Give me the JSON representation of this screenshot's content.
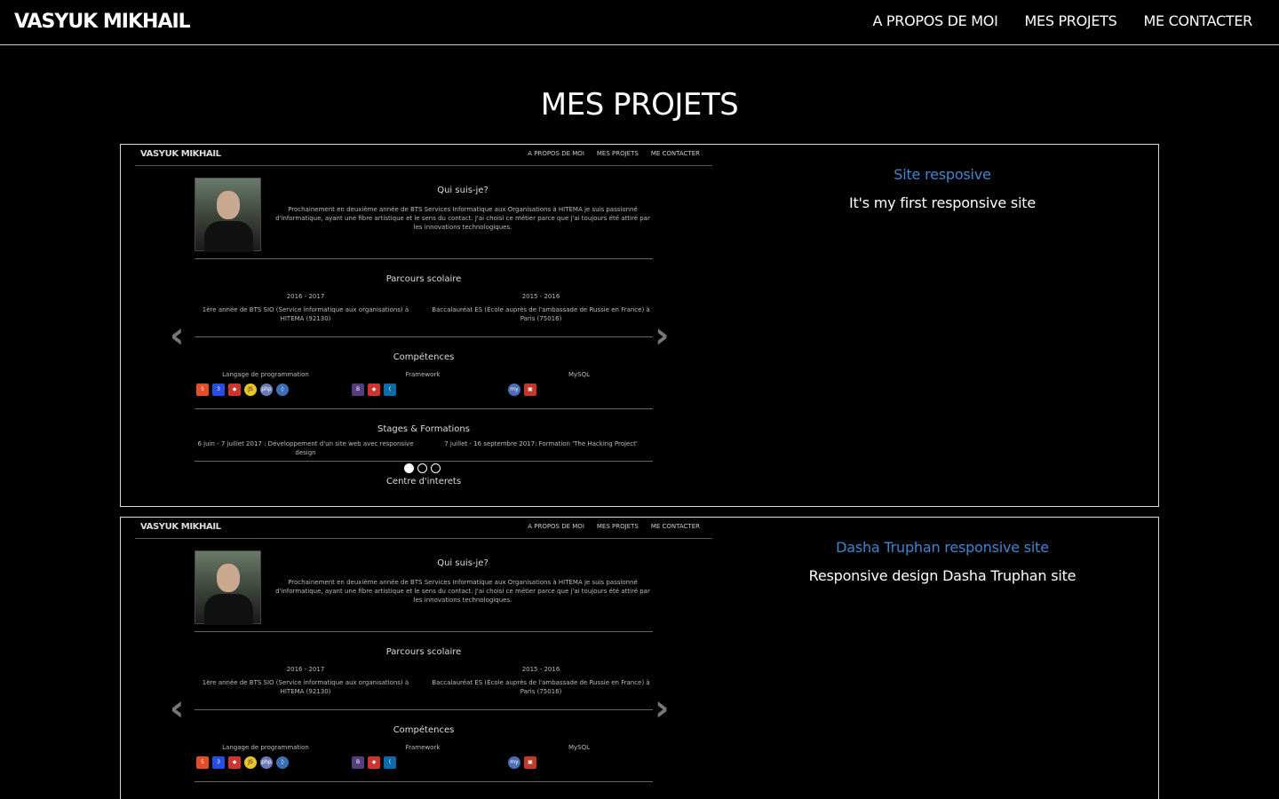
{
  "nav": {
    "brand": "VASYUK MIKHAIL",
    "links": [
      "A PROPOS DE MOI",
      "MES PROJETS",
      "ME CONTACTER"
    ]
  },
  "section_title": "MES PROJETS",
  "colors": {
    "background": "#000000",
    "link": "#3f86d1",
    "text": "#ffffff",
    "border": "#d9d9d9"
  },
  "preview": {
    "brand": "VASYUK MIKHAIL",
    "nav_links": [
      "A PROPOS DE MOI",
      "MES PROJETS",
      "ME CONTACTER"
    ],
    "about_title": "Qui suis-je?",
    "about_text": "Prochainement en deuxième année de BTS Services Informatique aux Organisations à HITEMA je suis passionné d'informatique, ayant une fibre artistique et le sens du contact. J'ai choisi ce métier parce que j'ai toujours été attiré par les innovations technologiques.",
    "school_title": "Parcours scolaire",
    "school": [
      {
        "years": "2016 - 2017",
        "text": "1ère année de BTS SIO (Service informatique aux organisations) à HITEMA (92130)"
      },
      {
        "years": "2015 - 2016",
        "text": "Baccalauréat ES (École auprès de l'ambassade de Russie en France) à Paris (75016)"
      }
    ],
    "skills_title": "Compétences",
    "skills": [
      "Langage de programmation",
      "Framework",
      "MySQL"
    ],
    "internships_title": "Stages & Formations",
    "internships": [
      "6 juin - 7 juillet 2017 : Développement d'un site web avec responsive design",
      "7 juillet - 16 septembre 2017: Formation 'The Hacking Project'"
    ],
    "interests_title": "Centre d'interets",
    "carousel_prev": "‹",
    "carousel_next": "›"
  },
  "projects": [
    {
      "title": "Site resposive",
      "description": "It's my first responsive site"
    },
    {
      "title": "Dasha Truphan responsive site",
      "description": "Responsive design Dasha Truphan site"
    }
  ]
}
